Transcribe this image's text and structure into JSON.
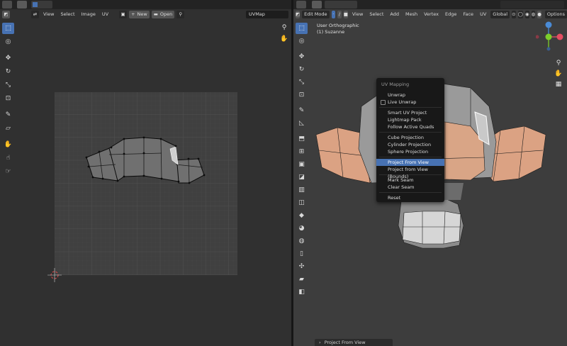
{
  "uv_editor": {
    "menus": [
      "View",
      "Select",
      "Image",
      "UV"
    ],
    "new_label": "New",
    "open_label": "Open",
    "uvmap_field": "UVMap"
  },
  "view3d": {
    "mode": "Edit Mode",
    "menus": [
      "View",
      "Select",
      "Add",
      "Mesh",
      "Vertex",
      "Edge",
      "Face",
      "UV"
    ],
    "transform_orientation": "Global",
    "options_label": "Options",
    "view_name": "User Orthographic",
    "object_name": "(1) Suzanne",
    "axes": {
      "x": "X",
      "y": "Y",
      "z": "Z"
    }
  },
  "uv_mapping_menu": {
    "title": "UV Mapping",
    "items": [
      "Unwrap",
      "Live Unwrap",
      "Smart UV Project",
      "Lightmap Pack",
      "Follow Active Quads",
      "Cube Projection",
      "Cylinder Projection",
      "Sphere Projection",
      "Project From View",
      "Project from View (Bounds)",
      "Mark Seam",
      "Clear Seam",
      "Reset"
    ],
    "highlighted": "Project From View"
  },
  "status_panel": {
    "last_operator": "Project From View"
  },
  "colors": {
    "accent": "#4772b3",
    "face_selected": "#e0a282",
    "axis_x": "#e44d62",
    "axis_y": "#7ccd2b",
    "axis_z": "#4a8bd6"
  }
}
